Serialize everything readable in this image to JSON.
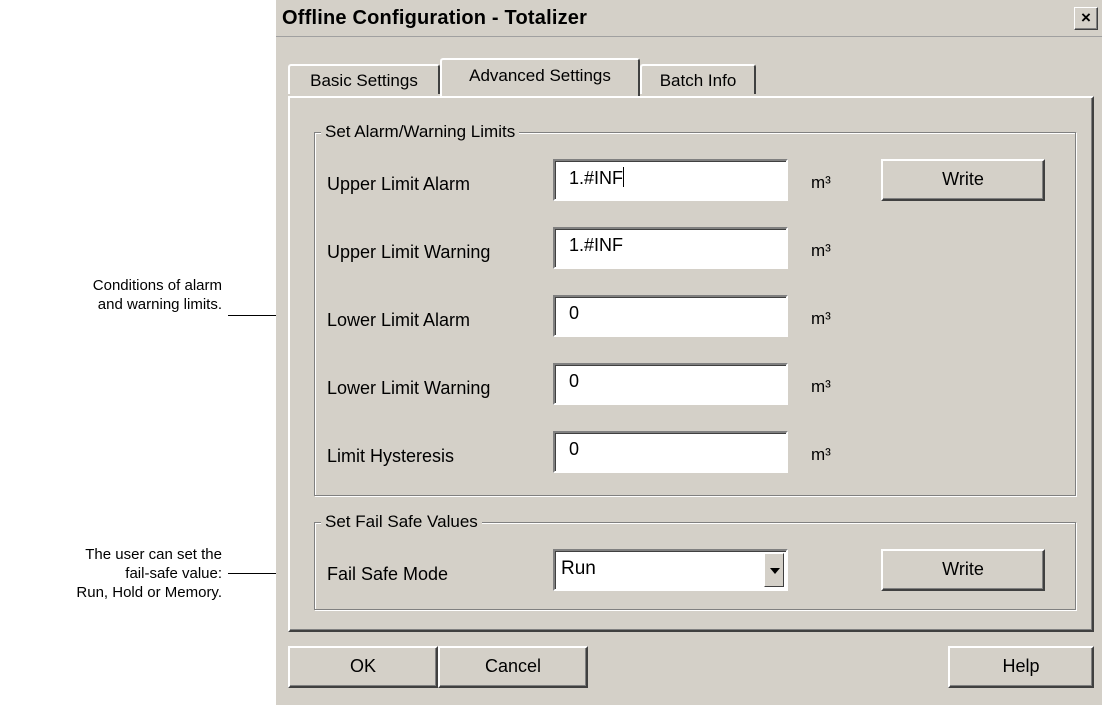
{
  "annotations": {
    "alarm_note_line1": "Conditions of alarm",
    "alarm_note_line2": "and warning limits.",
    "failsafe_note_line1": "The user can set the",
    "failsafe_note_line2": "fail-safe value:",
    "failsafe_note_line3": "Run, Hold or Memory."
  },
  "window": {
    "title": "Offline Configuration - Totalizer",
    "close_icon": "close-icon",
    "close_glyph": "×"
  },
  "tabs": [
    {
      "label": "Basic Settings",
      "active": false
    },
    {
      "label": "Advanced Settings",
      "active": true
    },
    {
      "label": "Batch Info",
      "active": false
    }
  ],
  "alarm_group": {
    "legend": "Set Alarm/Warning Limits",
    "write_label": "Write",
    "fields": [
      {
        "label": "Upper Limit Alarm",
        "value": "1.#INF",
        "unit": "m³"
      },
      {
        "label": "Upper Limit Warning",
        "value": "1.#INF",
        "unit": "m³"
      },
      {
        "label": "Lower Limit Alarm",
        "value": "0",
        "unit": "m³"
      },
      {
        "label": "Lower Limit Warning",
        "value": "0",
        "unit": "m³"
      },
      {
        "label": "Limit Hysteresis",
        "value": "0",
        "unit": "m³"
      }
    ]
  },
  "failsafe_group": {
    "legend": "Set Fail Safe Values",
    "label": "Fail Safe Mode",
    "selected": "Run",
    "dropdown_icon": "chevron-down-icon",
    "write_label": "Write"
  },
  "footer": {
    "ok_label": "OK",
    "cancel_label": "Cancel",
    "help_label": "Help"
  }
}
